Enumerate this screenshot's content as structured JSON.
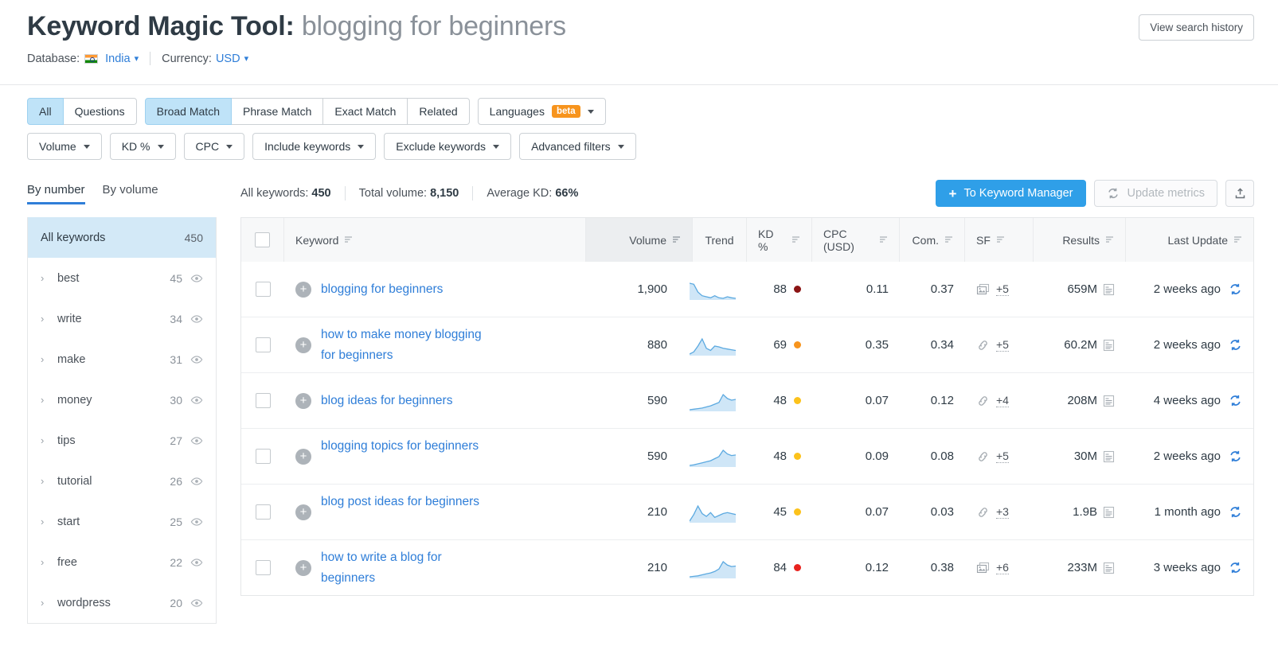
{
  "header": {
    "title_prefix": "Keyword Magic Tool:",
    "query": "blogging for beginners",
    "database_label": "Database:",
    "database_value": "India",
    "currency_label": "Currency:",
    "currency_value": "USD",
    "history_button": "View search history"
  },
  "filters": {
    "match_scope": [
      {
        "label": "All",
        "active": true
      },
      {
        "label": "Questions",
        "active": false
      }
    ],
    "match_types": [
      {
        "label": "Broad Match",
        "active": true
      },
      {
        "label": "Phrase Match",
        "active": false
      },
      {
        "label": "Exact Match",
        "active": false
      },
      {
        "label": "Related",
        "active": false
      }
    ],
    "languages": {
      "label": "Languages",
      "badge": "beta"
    },
    "metric_filters": [
      "Volume",
      "KD %",
      "CPC",
      "Include keywords",
      "Exclude keywords",
      "Advanced filters"
    ]
  },
  "stats": {
    "tabs": [
      {
        "label": "By number",
        "active": true
      },
      {
        "label": "By volume",
        "active": false
      }
    ],
    "all_keywords_label": "All keywords:",
    "all_keywords_value": "450",
    "total_volume_label": "Total volume:",
    "total_volume_value": "8,150",
    "average_kd_label": "Average KD:",
    "average_kd_value": "66%",
    "to_keyword_manager": "To Keyword Manager",
    "update_metrics": "Update metrics"
  },
  "sidebar": {
    "all_keywords": {
      "label": "All keywords",
      "count": "450"
    },
    "groups": [
      {
        "label": "best",
        "count": "45"
      },
      {
        "label": "write",
        "count": "34"
      },
      {
        "label": "make",
        "count": "31"
      },
      {
        "label": "money",
        "count": "30"
      },
      {
        "label": "tips",
        "count": "27"
      },
      {
        "label": "tutorial",
        "count": "26"
      },
      {
        "label": "start",
        "count": "25"
      },
      {
        "label": "free",
        "count": "22"
      },
      {
        "label": "wordpress",
        "count": "20"
      }
    ]
  },
  "table": {
    "columns": [
      "Keyword",
      "Volume",
      "Trend",
      "KD %",
      "CPC (USD)",
      "Com.",
      "SF",
      "Results",
      "Last Update"
    ],
    "rows": [
      {
        "keyword": "blogging for beginners",
        "volume": "1,900",
        "trend": [
          62,
          60,
          45,
          38,
          36,
          34,
          38,
          34,
          33,
          36,
          34,
          33
        ],
        "kd": "88",
        "kd_color": "#8b1414",
        "cpc": "0.11",
        "com": "0.37",
        "sf_icon": "images-icon",
        "sf_count": "+5",
        "results": "659M",
        "last_update": "2 weeks ago"
      },
      {
        "keyword": "how to make money blogging for beginners",
        "volume": "880",
        "trend": [
          30,
          36,
          52,
          72,
          46,
          40,
          52,
          50,
          46,
          44,
          42,
          40
        ],
        "kd": "69",
        "kd_color": "#f7941d",
        "cpc": "0.35",
        "com": "0.34",
        "sf_icon": "link-icon",
        "sf_count": "+5",
        "results": "60.2M",
        "last_update": "2 weeks ago"
      },
      {
        "keyword": "blog ideas for beginners",
        "volume": "590",
        "trend": [
          18,
          20,
          22,
          24,
          28,
          32,
          38,
          44,
          72,
          58,
          52,
          55
        ],
        "kd": "48",
        "kd_color": "#fcc21b",
        "cpc": "0.07",
        "com": "0.12",
        "sf_icon": "link-icon",
        "sf_count": "+4",
        "results": "208M",
        "last_update": "4 weeks ago"
      },
      {
        "keyword": "blogging topics for beginners",
        "volume": "590",
        "trend": [
          16,
          18,
          22,
          26,
          30,
          34,
          42,
          50,
          74,
          60,
          54,
          56
        ],
        "kd": "48",
        "kd_color": "#fcc21b",
        "cpc": "0.09",
        "com": "0.08",
        "sf_icon": "link-icon",
        "sf_count": "+5",
        "results": "30M",
        "last_update": "2 weeks ago"
      },
      {
        "keyword": "blog post ideas for beginners",
        "volume": "210",
        "trend": [
          34,
          48,
          66,
          50,
          44,
          52,
          42,
          46,
          50,
          52,
          50,
          48
        ],
        "kd": "45",
        "kd_color": "#fcc21b",
        "cpc": "0.07",
        "com": "0.03",
        "sf_icon": "link-icon",
        "sf_count": "+3",
        "results": "1.9B",
        "last_update": "1 month ago"
      },
      {
        "keyword": "how to write a blog for beginners",
        "volume": "210",
        "trend": [
          14,
          16,
          18,
          22,
          26,
          30,
          36,
          46,
          76,
          62,
          56,
          58
        ],
        "kd": "84",
        "kd_color": "#e8231f",
        "cpc": "0.12",
        "com": "0.38",
        "sf_icon": "images-icon",
        "sf_count": "+6",
        "results": "233M",
        "last_update": "3 weeks ago"
      }
    ]
  },
  "colors": {
    "link": "#2f7ed8",
    "primary": "#2f9fe8",
    "active_tab_bg": "#bfe3f8",
    "sidebar_selected": "#d3e9f7",
    "beta_badge": "#f7941d",
    "trend_line": "#5ba9e0",
    "trend_fill": "#cfe6f7"
  }
}
